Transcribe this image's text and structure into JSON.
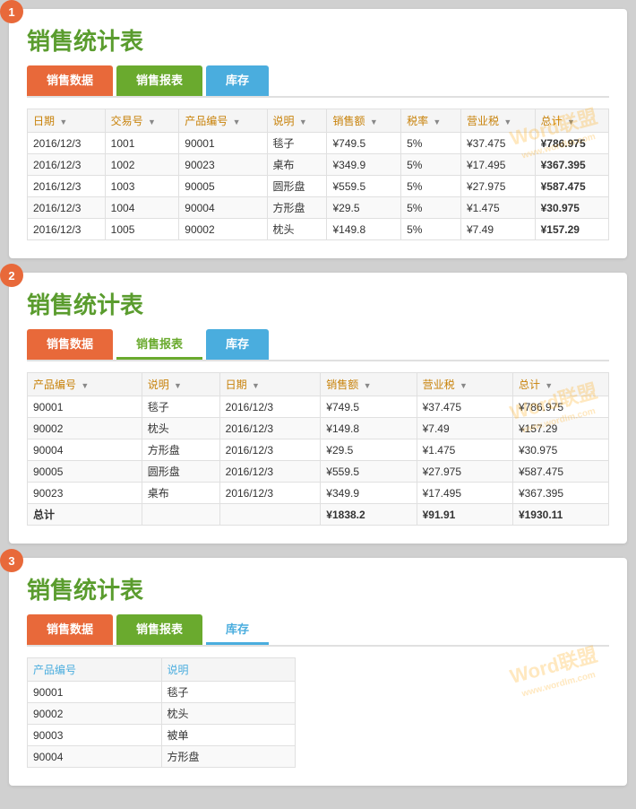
{
  "sections": [
    {
      "number": "1",
      "title": "销售统计表",
      "tabs": [
        {
          "label": "销售数据",
          "style": "active-orange"
        },
        {
          "label": "销售报表",
          "style": "green"
        },
        {
          "label": "库存",
          "style": "blue"
        }
      ],
      "table": {
        "headers": [
          "日期",
          "交易号",
          "产品编号",
          "说明",
          "销售额",
          "税率",
          "营业税",
          "总计"
        ],
        "rows": [
          [
            "2016/12/3",
            "1001",
            "90001",
            "毯子",
            "¥749.5",
            "5%",
            "¥37.475",
            "¥786.975"
          ],
          [
            "2016/12/3",
            "1002",
            "90023",
            "桌布",
            "¥349.9",
            "5%",
            "¥17.495",
            "¥367.395"
          ],
          [
            "2016/12/3",
            "1003",
            "90005",
            "圆形盘",
            "¥559.5",
            "5%",
            "¥27.975",
            "¥587.475"
          ],
          [
            "2016/12/3",
            "1004",
            "90004",
            "方形盘",
            "¥29.5",
            "5%",
            "¥1.475",
            "¥30.975"
          ],
          [
            "2016/12/3",
            "1005",
            "90002",
            "枕头",
            "¥149.8",
            "5%",
            "¥7.49",
            "¥157.29"
          ]
        ]
      }
    },
    {
      "number": "2",
      "title": "销售统计表",
      "tabs": [
        {
          "label": "销售数据",
          "style": "active-orange"
        },
        {
          "label": "销售报表",
          "style": "underline-green"
        },
        {
          "label": "库存",
          "style": "active-blue"
        }
      ],
      "table": {
        "headers": [
          "产品编号",
          "说明",
          "日期",
          "销售额",
          "营业税",
          "总计"
        ],
        "rows": [
          [
            "90001",
            "毯子",
            "2016/12/3",
            "¥749.5",
            "¥37.475",
            "¥786.975"
          ],
          [
            "90002",
            "枕头",
            "2016/12/3",
            "¥149.8",
            "¥7.49",
            "¥157.29"
          ],
          [
            "90004",
            "方形盘",
            "2016/12/3",
            "¥29.5",
            "¥1.475",
            "¥30.975"
          ],
          [
            "90005",
            "圆形盘",
            "2016/12/3",
            "¥559.5",
            "¥27.975",
            "¥587.475"
          ],
          [
            "90023",
            "桌布",
            "2016/12/3",
            "¥349.9",
            "¥17.495",
            "¥367.395"
          ],
          [
            "总计",
            "",
            "",
            "¥1838.2",
            "¥91.91",
            "¥1930.11"
          ]
        ]
      }
    },
    {
      "number": "3",
      "title": "销售统计表",
      "tabs": [
        {
          "label": "销售数据",
          "style": "active-orange"
        },
        {
          "label": "销售报表",
          "style": "active-green"
        },
        {
          "label": "库存",
          "style": "underline-blue"
        }
      ],
      "table": {
        "headers": [
          "产品编号",
          "说明"
        ],
        "rows": [
          [
            "90001",
            "毯子"
          ],
          [
            "90002",
            "枕头"
          ],
          [
            "90003",
            "被单"
          ],
          [
            "90004",
            "方形盘"
          ]
        ]
      }
    }
  ],
  "watermark": {
    "line1": "Word联盟",
    "line2": "www.wordlm.com"
  }
}
